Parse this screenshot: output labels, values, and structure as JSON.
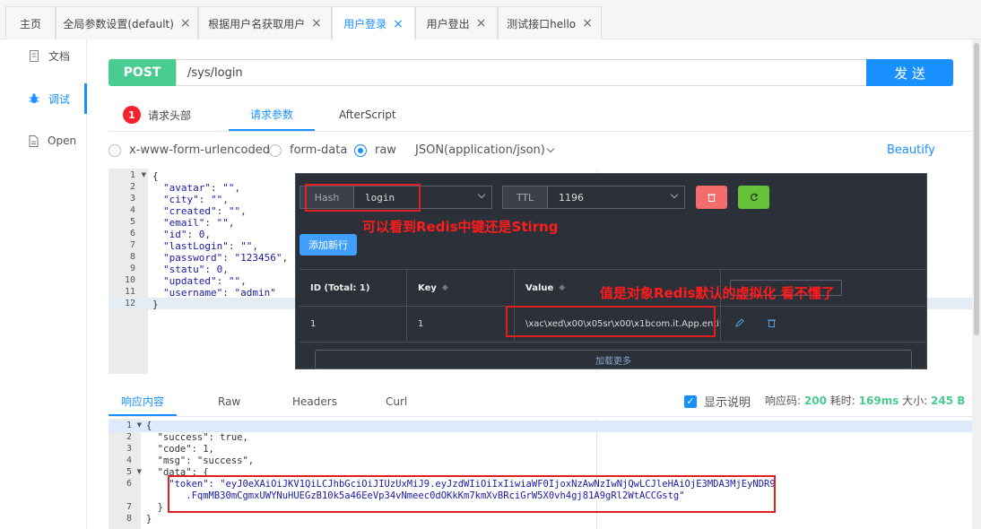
{
  "tabs": [
    {
      "label": "主页",
      "closable": false
    },
    {
      "label": "全局参数设置(default)",
      "closable": true
    },
    {
      "label": "根据用户名获取用户",
      "closable": true
    },
    {
      "label": "用户登录",
      "closable": true,
      "active": true
    },
    {
      "label": "用户登出",
      "closable": true
    },
    {
      "label": "测试接口hello",
      "closable": true
    }
  ],
  "close_glyph": "×",
  "sidebar": {
    "items": [
      {
        "label": "文档",
        "icon": "doc-icon"
      },
      {
        "label": "调试",
        "icon": "bug-icon",
        "active": true
      },
      {
        "label": "Open",
        "icon": "file-icon"
      }
    ]
  },
  "request": {
    "method": "POST",
    "url": "/sys/login",
    "send_label": "发 送",
    "subtabs": [
      {
        "label": "请求头部",
        "badge": "1"
      },
      {
        "label": "请求参数",
        "active": true
      },
      {
        "label": "AfterScript"
      }
    ],
    "body_types": [
      {
        "label": "x-www-form-urlencoded",
        "checked": false
      },
      {
        "label": "form-data",
        "checked": false
      },
      {
        "label": "raw",
        "checked": true
      }
    ],
    "content_type": "JSON(application/json)",
    "beautify_label": "Beautify",
    "editor_lines": [
      {
        "n": "1",
        "fold": true,
        "code": "{"
      },
      {
        "n": "2",
        "key": "\"avatar\"",
        "val": "\"\"",
        "tail": ","
      },
      {
        "n": "3",
        "key": "\"city\"",
        "val": "\"\"",
        "tail": ","
      },
      {
        "n": "4",
        "key": "\"created\"",
        "val": "\"\"",
        "tail": ","
      },
      {
        "n": "5",
        "key": "\"email\"",
        "val": "\"\"",
        "tail": ","
      },
      {
        "n": "6",
        "key": "\"id\"",
        "val": "0",
        "tail": ","
      },
      {
        "n": "7",
        "key": "\"lastLogin\"",
        "val": "\"\"",
        "tail": ","
      },
      {
        "n": "8",
        "key": "\"password\"",
        "val": "\"123456\"",
        "tail": ","
      },
      {
        "n": "9",
        "key": "\"statu\"",
        "val": "0",
        "tail": ","
      },
      {
        "n": "10",
        "key": "\"updated\"",
        "val": "\"\"",
        "tail": ","
      },
      {
        "n": "11",
        "key": "\"username\"",
        "val": "\"admin\"",
        "tail": ""
      },
      {
        "n": "12",
        "code": "}"
      }
    ]
  },
  "redis": {
    "key_type_label": "Hash",
    "key_name": "login",
    "ttl_label": "TTL",
    "ttl_value": "1196",
    "add_row_label": "添加新行",
    "columns": [
      "ID (Total: 1)",
      "Key",
      "Value"
    ],
    "row": {
      "id": "1",
      "key": "1",
      "value": "\\xac\\xed\\x00\\x05sr\\x00\\x1bcom.it.App.entity.Lo..."
    },
    "load_more_label": "加载更多"
  },
  "annotations": {
    "key_note": "可以看到Redis中键还是Stirng",
    "value_note": "值是对象Redis默认的虚拟化   看不懂了"
  },
  "response": {
    "tabs": [
      {
        "label": "响应内容",
        "active": true
      },
      {
        "label": "Raw"
      },
      {
        "label": "Headers"
      },
      {
        "label": "Curl"
      }
    ],
    "show_desc_label": "显示说明",
    "code_label": "响应码:",
    "code": "200",
    "time_label": "耗时:",
    "time": "169ms",
    "size_label": "大小:",
    "size": "245 B",
    "lines": [
      {
        "n": "1",
        "fold": true,
        "code": "{"
      },
      {
        "n": "2",
        "code": "  \"success\": true,"
      },
      {
        "n": "3",
        "code": "  \"code\": 1,"
      },
      {
        "n": "4",
        "code": "  \"msg\": \"success\","
      },
      {
        "n": "5",
        "fold": true,
        "code": "  \"data\": {"
      },
      {
        "n": "6",
        "key": "    \"token\": ",
        "val": "\"eyJ0eXAiOiJKV1QiLCJhbGciOiJIUzUxMiJ9.eyJzdWIiOiIxIiwiaWF0IjoxNzAwNzIwNjQwLCJleHAiOjE3MDA3MjEyNDR9"
      },
      {
        "n": "",
        "val": "       .FqmMB30mCgmxUWYNuHUEGzB10k5a46EeVp34vNmeec0dOKkKm7kmXvBRciGrW5X0vh4gj81A9gRl2WtACCGstg\""
      },
      {
        "n": "7",
        "code": "  }"
      },
      {
        "n": "8",
        "code": "}"
      }
    ]
  },
  "colors": {
    "primary": "#1890ff",
    "post": "#49cc90",
    "annotation": "#ff1c1c"
  }
}
